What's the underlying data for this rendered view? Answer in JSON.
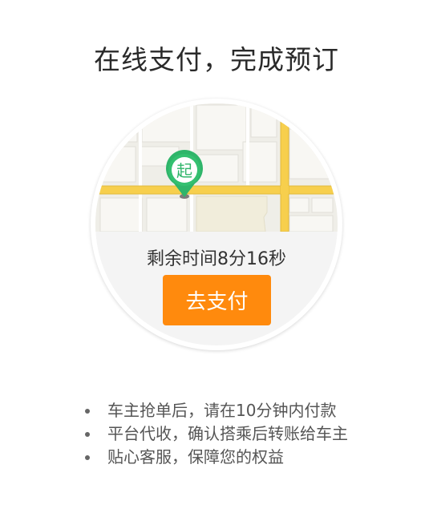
{
  "page": {
    "title": "在线支付，完成预订"
  },
  "map": {
    "start_marker_label": "起",
    "marker_color": "#2fb56a",
    "road_color": "#f7cf4d"
  },
  "payment": {
    "countdown_text": "剩余时间8分16秒",
    "pay_button_label": "去支付",
    "button_color": "#ff8a0d"
  },
  "benefits": [
    {
      "text": "车主抢单后，请在10分钟内付款"
    },
    {
      "text": "平台代收，确认搭乘后转账给车主"
    },
    {
      "text": "贴心客服，保障您的权益"
    }
  ]
}
